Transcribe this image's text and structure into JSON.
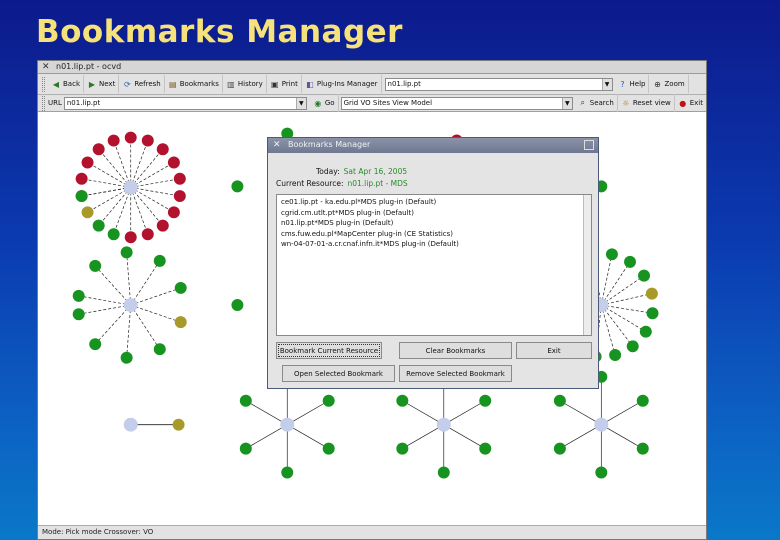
{
  "slide_title": "Bookmarks Manager",
  "window": {
    "title": "n01.lip.pt - ocvd",
    "status_text": "Mode: Pick mode  Crossover: VO"
  },
  "toolbar": {
    "back": "Back",
    "next": "Next",
    "refresh": "Refresh",
    "bookmarks": "Bookmarks",
    "history": "History",
    "print": "Print",
    "plugins_manager": "Plug-Ins Manager",
    "resource_combo": "n01.lip.pt",
    "help": "Help",
    "zoom": "Zoom"
  },
  "addressbar": {
    "url_label": "URL",
    "url_value": "n01.lip.pt",
    "go_label": "Go",
    "view_value": "Grid VO Sites View Model",
    "search": "Search",
    "reset_view": "Reset view",
    "exit": "Exit"
  },
  "dialog": {
    "title": "Bookmarks Manager",
    "today_label": "Today:",
    "today_value": "Sat Apr 16, 2005",
    "resource_label": "Current Resource:",
    "resource_value": "n01.lip.pt - MDS",
    "bookmarks": [
      "ce01.lip.pt - ka.edu.pl*MDS plug-in (Default)",
      "cgrid.cm.utlt.pt*MDS plug-in (Default)",
      "n01.lip.pt*MDS plug-in (Default)",
      "cms.fuw.edu.pl*MapCenter plug-in (CE Statistics)",
      "wn-04-07-01-a.cr.cnaf.infn.it*MDS plug-in (Default)"
    ],
    "btn_bookmark_current": "Bookmark Current Resource",
    "btn_clear": "Clear Bookmarks",
    "btn_exit": "Exit",
    "btn_open": "Open Selected Bookmark",
    "btn_remove": "Remove Selected Bookmark"
  },
  "colors": {
    "node_red": "#b3122e",
    "node_green": "#17931f",
    "node_olive": "#a89a2a",
    "node_hub": "#c4cdea",
    "title_yellow": "#f6e27a"
  }
}
